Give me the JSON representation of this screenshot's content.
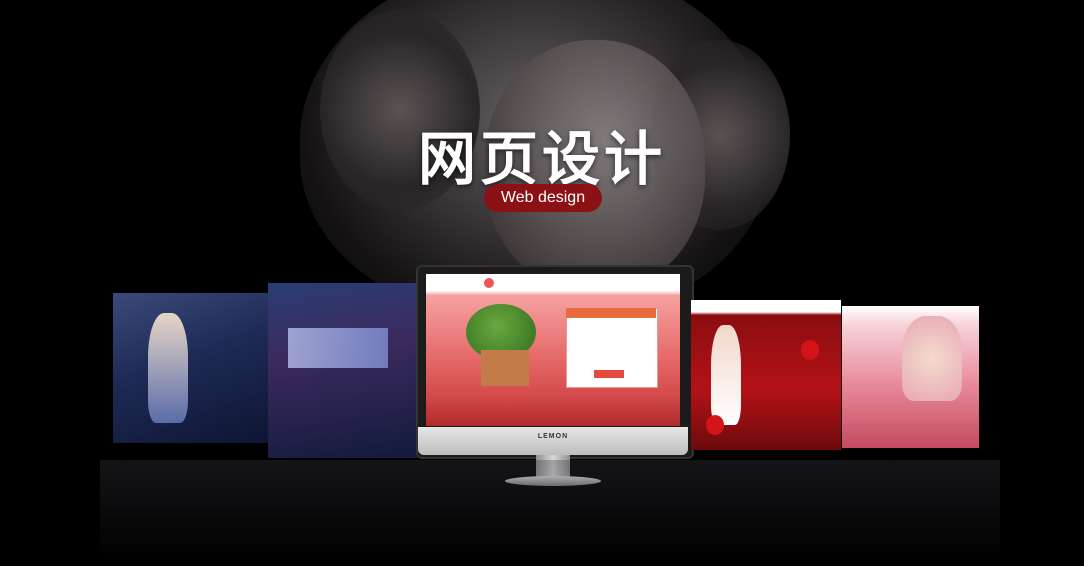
{
  "title": "网页设计",
  "subtitle": "Web design",
  "monitor": {
    "brand": "LEMON"
  },
  "colors": {
    "background": "#000000",
    "badge": "#8b1115",
    "title": "#ffffff"
  }
}
